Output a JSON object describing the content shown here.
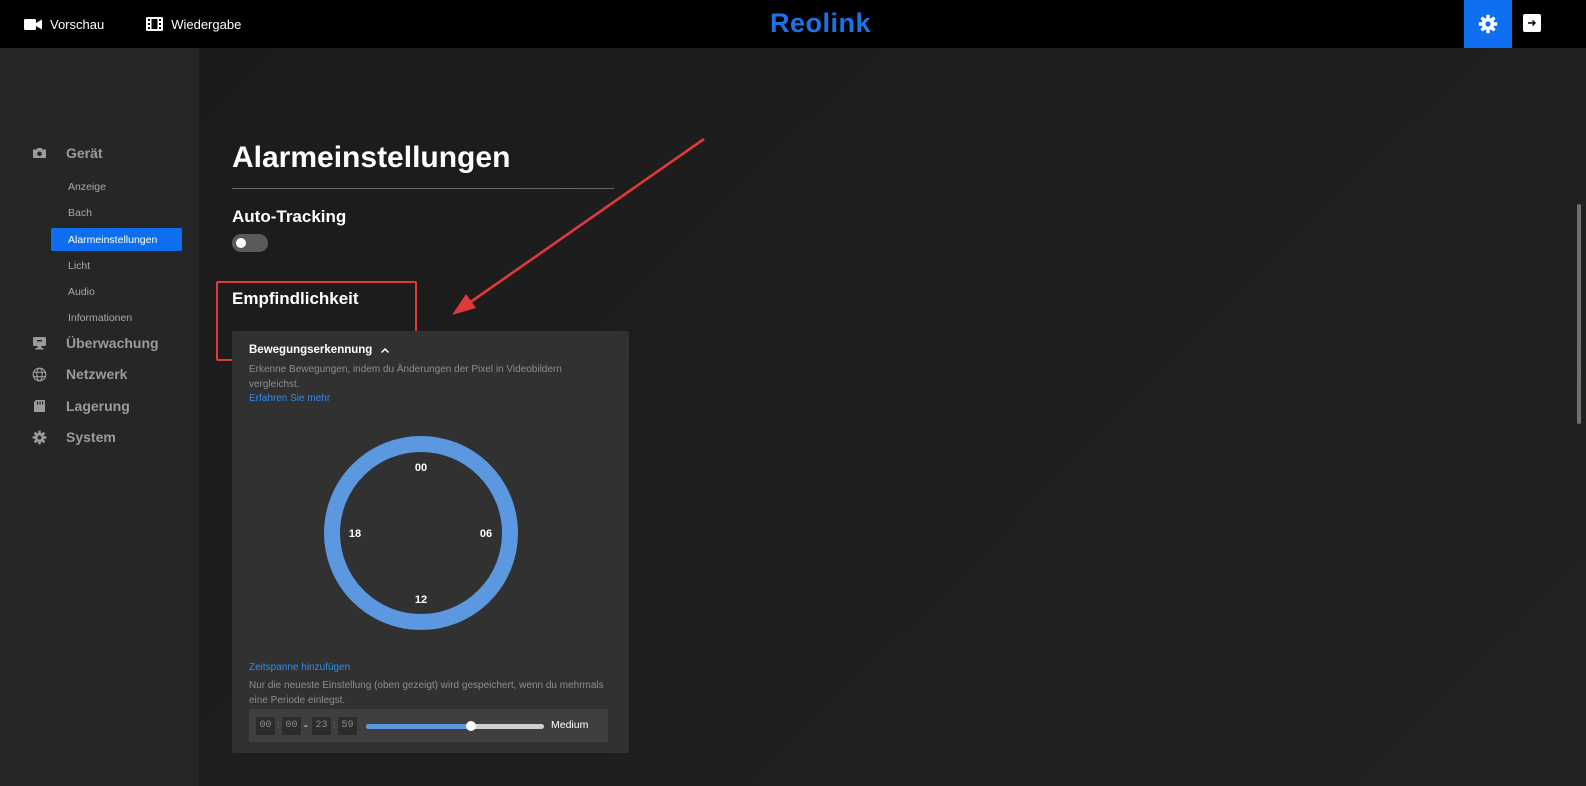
{
  "topbar": {
    "nav": [
      {
        "label": "Vorschau",
        "icon": "camera-icon"
      },
      {
        "label": "Wiedergabe",
        "icon": "film-icon"
      }
    ],
    "logo": "Reolink",
    "accent_color": "#0d6ff0"
  },
  "sidebar": {
    "groups": [
      {
        "label": "Gerät",
        "icon": "camera-icon"
      },
      {
        "label": "Überwachung",
        "icon": "monitor-icon"
      },
      {
        "label": "Netzwerk",
        "icon": "globe-icon"
      },
      {
        "label": "Lagerung",
        "icon": "storage-icon"
      },
      {
        "label": "System",
        "icon": "gear-icon"
      }
    ],
    "sub_items": [
      {
        "label": "Anzeige",
        "active": false
      },
      {
        "label": "Bach",
        "active": false
      },
      {
        "label": "Alarmeinstellungen",
        "active": true
      },
      {
        "label": "Licht",
        "active": false
      },
      {
        "label": "Audio",
        "active": false
      },
      {
        "label": "Informationen",
        "active": false
      }
    ]
  },
  "main": {
    "title": "Alarmeinstellungen",
    "auto_tracking": {
      "label": "Auto-Tracking",
      "enabled": false
    },
    "sensitivity": {
      "title": "Empfindlichkeit",
      "panel": {
        "header": "Bewegungserkennung",
        "description": "Erkenne Bewegungen, indem du Änderungen der Pixel in Videobildern vergleichst.",
        "learn_more": "Erfahren Sie mehr",
        "clock_labels": {
          "top": "00",
          "right": "06",
          "bottom": "12",
          "left": "18"
        },
        "clock_color": "#5b98e0",
        "add_period": "Zeitspanne hinzufügen",
        "note": "Nur die neueste Einstellung (oben gezeigt) wird gespeichert, wenn du mehrmals eine Periode einlegst.",
        "time_range": {
          "start_h": "00",
          "start_m": "00",
          "end_h": "23",
          "end_m": "59",
          "separator": ":",
          "dash": "-"
        },
        "sensitivity_level": 0.59,
        "sensitivity_label": "Medium"
      }
    }
  }
}
